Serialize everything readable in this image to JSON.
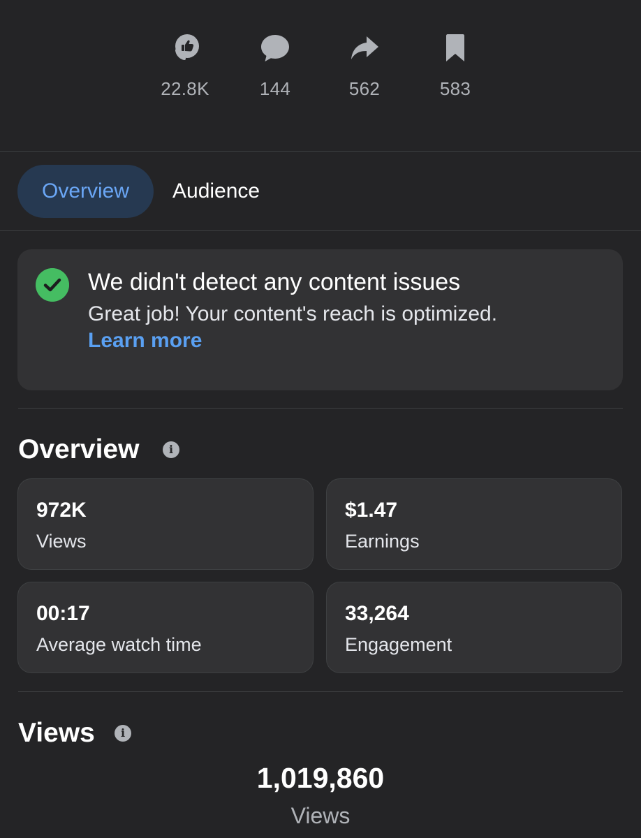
{
  "stats": [
    {
      "icon": "like-reaction-icon",
      "count": "22.8K"
    },
    {
      "icon": "comment-icon",
      "count": "144"
    },
    {
      "icon": "share-icon",
      "count": "562"
    },
    {
      "icon": "bookmark-icon",
      "count": "583"
    }
  ],
  "tabs": {
    "active": "Overview",
    "other": "Audience"
  },
  "notice": {
    "title": "We didn't detect any content issues",
    "description": "Great job! Your content's reach is optimized.",
    "link": "Learn more"
  },
  "overview": {
    "title": "Overview",
    "metrics": [
      {
        "value": "972K",
        "label": "Views"
      },
      {
        "value": "$1.47",
        "label": "Earnings"
      },
      {
        "value": "00:17",
        "label": "Average watch time"
      },
      {
        "value": "33,264",
        "label": "Engagement"
      }
    ]
  },
  "views": {
    "title": "Views",
    "total": "1,019,860",
    "total_label": "Views"
  },
  "colors": {
    "background": "#242426",
    "card": "#323234",
    "accent_blue": "#5aa0f2",
    "active_tab_bg": "#263951",
    "success_green": "#45bd62",
    "muted_text": "#b0b3b8"
  }
}
